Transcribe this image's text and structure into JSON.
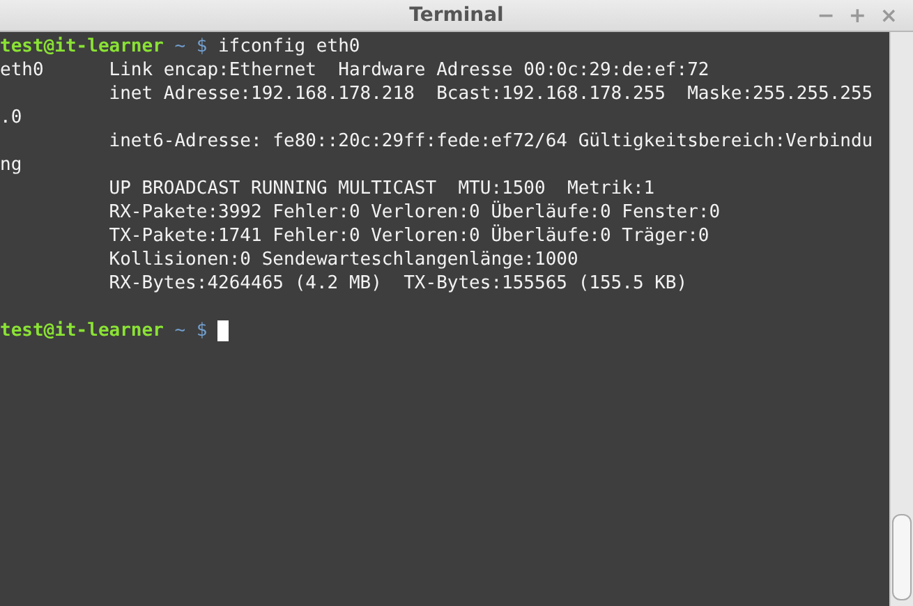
{
  "window": {
    "title": "Terminal",
    "controls": [
      "−",
      "+",
      "×"
    ]
  },
  "terminal": {
    "lines": [
      {
        "kind": "prompt",
        "user": "test@it-learner",
        "symbol": "~ $",
        "command": "ifconfig eth0",
        "cursor": false
      },
      {
        "kind": "output",
        "text": "eth0      Link encap:Ethernet  Hardware Adresse 00:0c:29:de:ef:72"
      },
      {
        "kind": "output",
        "text": "          inet Adresse:192.168.178.218  Bcast:192.168.178.255  Maske:255.255.255"
      },
      {
        "kind": "output",
        "text": ".0"
      },
      {
        "kind": "output",
        "text": "          inet6-Adresse: fe80::20c:29ff:fede:ef72/64 Gültigkeitsbereich:Verbindu"
      },
      {
        "kind": "output",
        "text": "ng"
      },
      {
        "kind": "output",
        "text": "          UP BROADCAST RUNNING MULTICAST  MTU:1500  Metrik:1"
      },
      {
        "kind": "output",
        "text": "          RX-Pakete:3992 Fehler:0 Verloren:0 Überläufe:0 Fenster:0"
      },
      {
        "kind": "output",
        "text": "          TX-Pakete:1741 Fehler:0 Verloren:0 Überläufe:0 Träger:0"
      },
      {
        "kind": "output",
        "text": "          Kollisionen:0 Sendewarteschlangenlänge:1000"
      },
      {
        "kind": "output",
        "text": "          RX-Bytes:4264465 (4.2 MB)  TX-Bytes:155565 (155.5 KB)"
      },
      {
        "kind": "blank"
      },
      {
        "kind": "prompt",
        "user": "test@it-learner",
        "symbol": "~ $",
        "cursor": true
      }
    ]
  }
}
